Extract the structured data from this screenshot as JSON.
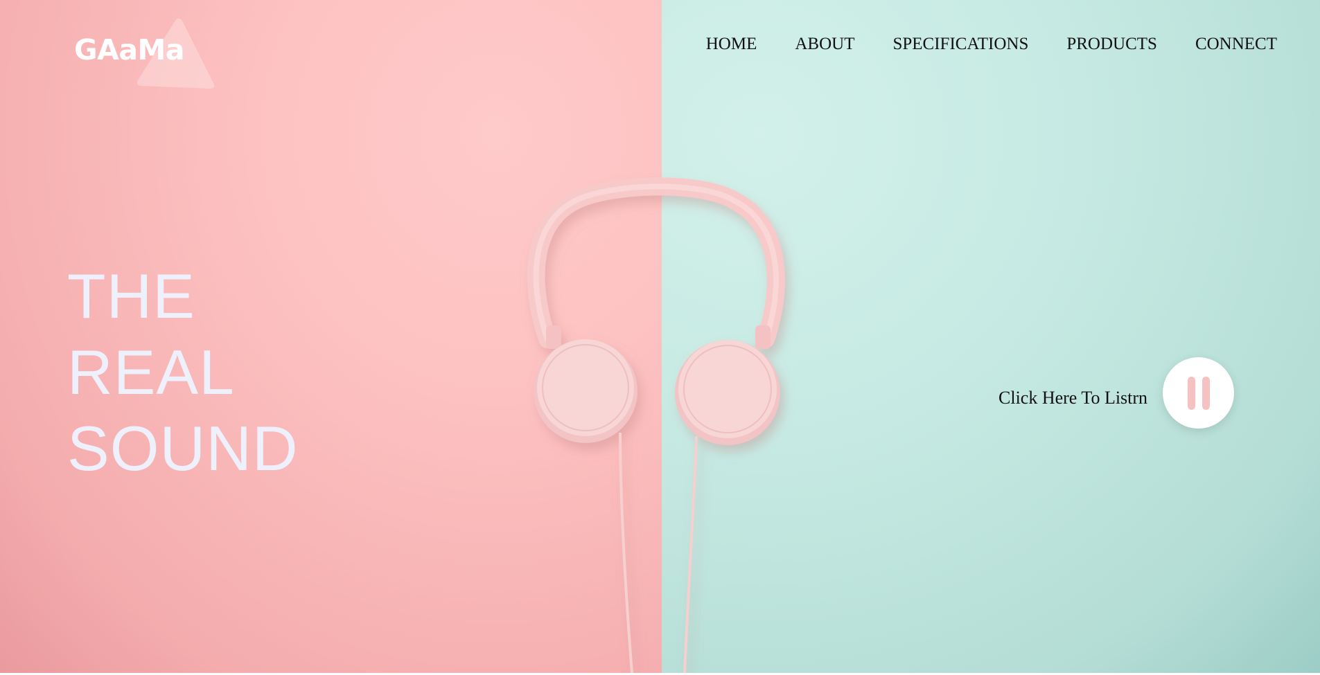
{
  "brand": {
    "logo_text": "GAaMa"
  },
  "nav": {
    "items": [
      {
        "label": "HOME"
      },
      {
        "label": "ABOUT"
      },
      {
        "label": "SPECIFICATIONS"
      },
      {
        "label": "PRODUCTS"
      },
      {
        "label": "CONNECT"
      }
    ]
  },
  "hero": {
    "headline_lines": [
      "THE",
      "REAL",
      "SOUND"
    ],
    "listen_label": "Click Here To Listrn",
    "player_icon": "pause-icon"
  },
  "colors": {
    "left_background": "#fdc1c1",
    "right_background": "#c6eae3",
    "headline_text": "#eef1fb",
    "accent_pink": "#f6c1c1"
  }
}
